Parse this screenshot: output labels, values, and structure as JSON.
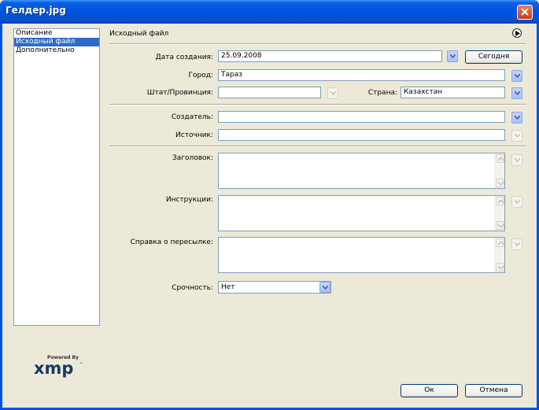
{
  "window": {
    "title": "Гелдер.jpg"
  },
  "nav": {
    "items": [
      {
        "label": "Описание",
        "selected": false
      },
      {
        "label": "Исходный файл",
        "selected": true
      },
      {
        "label": "Дополнительно",
        "selected": false
      }
    ]
  },
  "panel": {
    "heading": "Исходный файл"
  },
  "fields": {
    "date_label": "Дата создания:",
    "date_value": "25.09.2008",
    "today_button": "Сегодня",
    "city_label": "Город:",
    "city_value": "Тараз",
    "state_label": "Штат/Провинция:",
    "state_value": "",
    "country_label": "Страна:",
    "country_value": "Казахстан",
    "creator_label": "Создатель:",
    "creator_value": "",
    "source_label": "Источник:",
    "source_value": "",
    "headline_label": "Заголовок:",
    "instructions_label": "Инструкции:",
    "transfer_label": "Справка о пересылке:",
    "urgency_label": "Срочность:",
    "urgency_value": "Нет"
  },
  "branding": {
    "powered_by": "Powered By",
    "logo_text": "xmp",
    "trademark": "™"
  },
  "buttons": {
    "ok": "Ок",
    "cancel": "Отмена"
  },
  "colors": {
    "titlebar": "#0054e3",
    "selection": "#316ac5",
    "dialog_bg": "#ece9d8"
  }
}
